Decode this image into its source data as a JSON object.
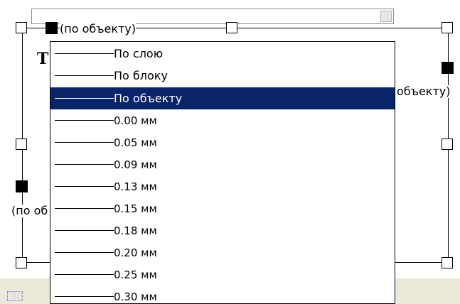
{
  "frame": {
    "label_top": "(по объекту)",
    "label_right": "объекту)",
    "label_left": "(по об",
    "big_letter": "T"
  },
  "dropdown": {
    "selected_index": 2,
    "options": [
      {
        "label": "По слою"
      },
      {
        "label": "По блоку"
      },
      {
        "label": "По объекту"
      },
      {
        "label": "0.00 мм"
      },
      {
        "label": "0.05 мм"
      },
      {
        "label": "0.09 мм"
      },
      {
        "label": "0.13 мм"
      },
      {
        "label": "0.15 мм"
      },
      {
        "label": "0.18 мм"
      },
      {
        "label": "0.20 мм"
      },
      {
        "label": "0.25 мм"
      },
      {
        "label": "0.30 мм"
      }
    ]
  },
  "colors": {
    "selection": "#0a246a",
    "window_bg": "#ece9d8"
  }
}
